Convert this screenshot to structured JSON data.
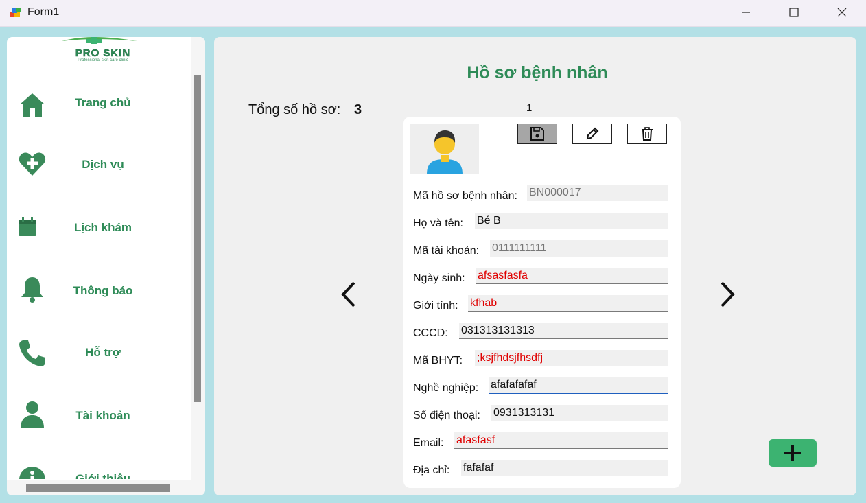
{
  "window": {
    "title": "Form1"
  },
  "logo": {
    "brand": "PRO SKIN",
    "tagline": "Professional skin care clinic"
  },
  "sidebar": {
    "items": [
      {
        "label": "Trang chủ",
        "icon": "home-icon"
      },
      {
        "label": "Dịch vụ",
        "icon": "heart-plus-icon"
      },
      {
        "label": "Lịch khám",
        "icon": "calendar-icon"
      },
      {
        "label": "Thông báo",
        "icon": "bell-icon"
      },
      {
        "label": "Hỗ trợ",
        "icon": "phone-icon"
      },
      {
        "label": "Tài khoản",
        "icon": "user-icon"
      },
      {
        "label": "Giới thiệu",
        "icon": "info-icon"
      }
    ]
  },
  "main": {
    "title": "Hồ sơ bệnh nhân",
    "total_label": "Tổng số hồ sơ:",
    "total_value": "3",
    "page_index": "1"
  },
  "card": {
    "fields": [
      {
        "label": "Mã hồ sơ bệnh nhân:",
        "value": "BN000017"
      },
      {
        "label": "Họ và tên:",
        "value": "Bé B"
      },
      {
        "label": "Mã tài khoản:",
        "value": "0111111111"
      },
      {
        "label": "Ngày sinh:",
        "value": "afsasfasfa"
      },
      {
        "label": "Giới tính:",
        "value": "kfhab"
      },
      {
        "label": "CCCD:",
        "value": "031313131313"
      },
      {
        "label": "Mã BHYT:",
        "value": ";ksjfhdsjfhsdfj"
      },
      {
        "label": "Nghề nghiệp:",
        "value": "afafafafaf"
      },
      {
        "label": "Số điện thoại:",
        "value": "0931313131"
      },
      {
        "label": "Email:",
        "value": "afasfasf"
      },
      {
        "label": "Địa chỉ:",
        "value": "fafafaf"
      }
    ]
  },
  "colors": {
    "accent": "#2e8b57",
    "add_button": "#3cb371",
    "error_text": "#e00000",
    "background": "#b3e0e6"
  }
}
